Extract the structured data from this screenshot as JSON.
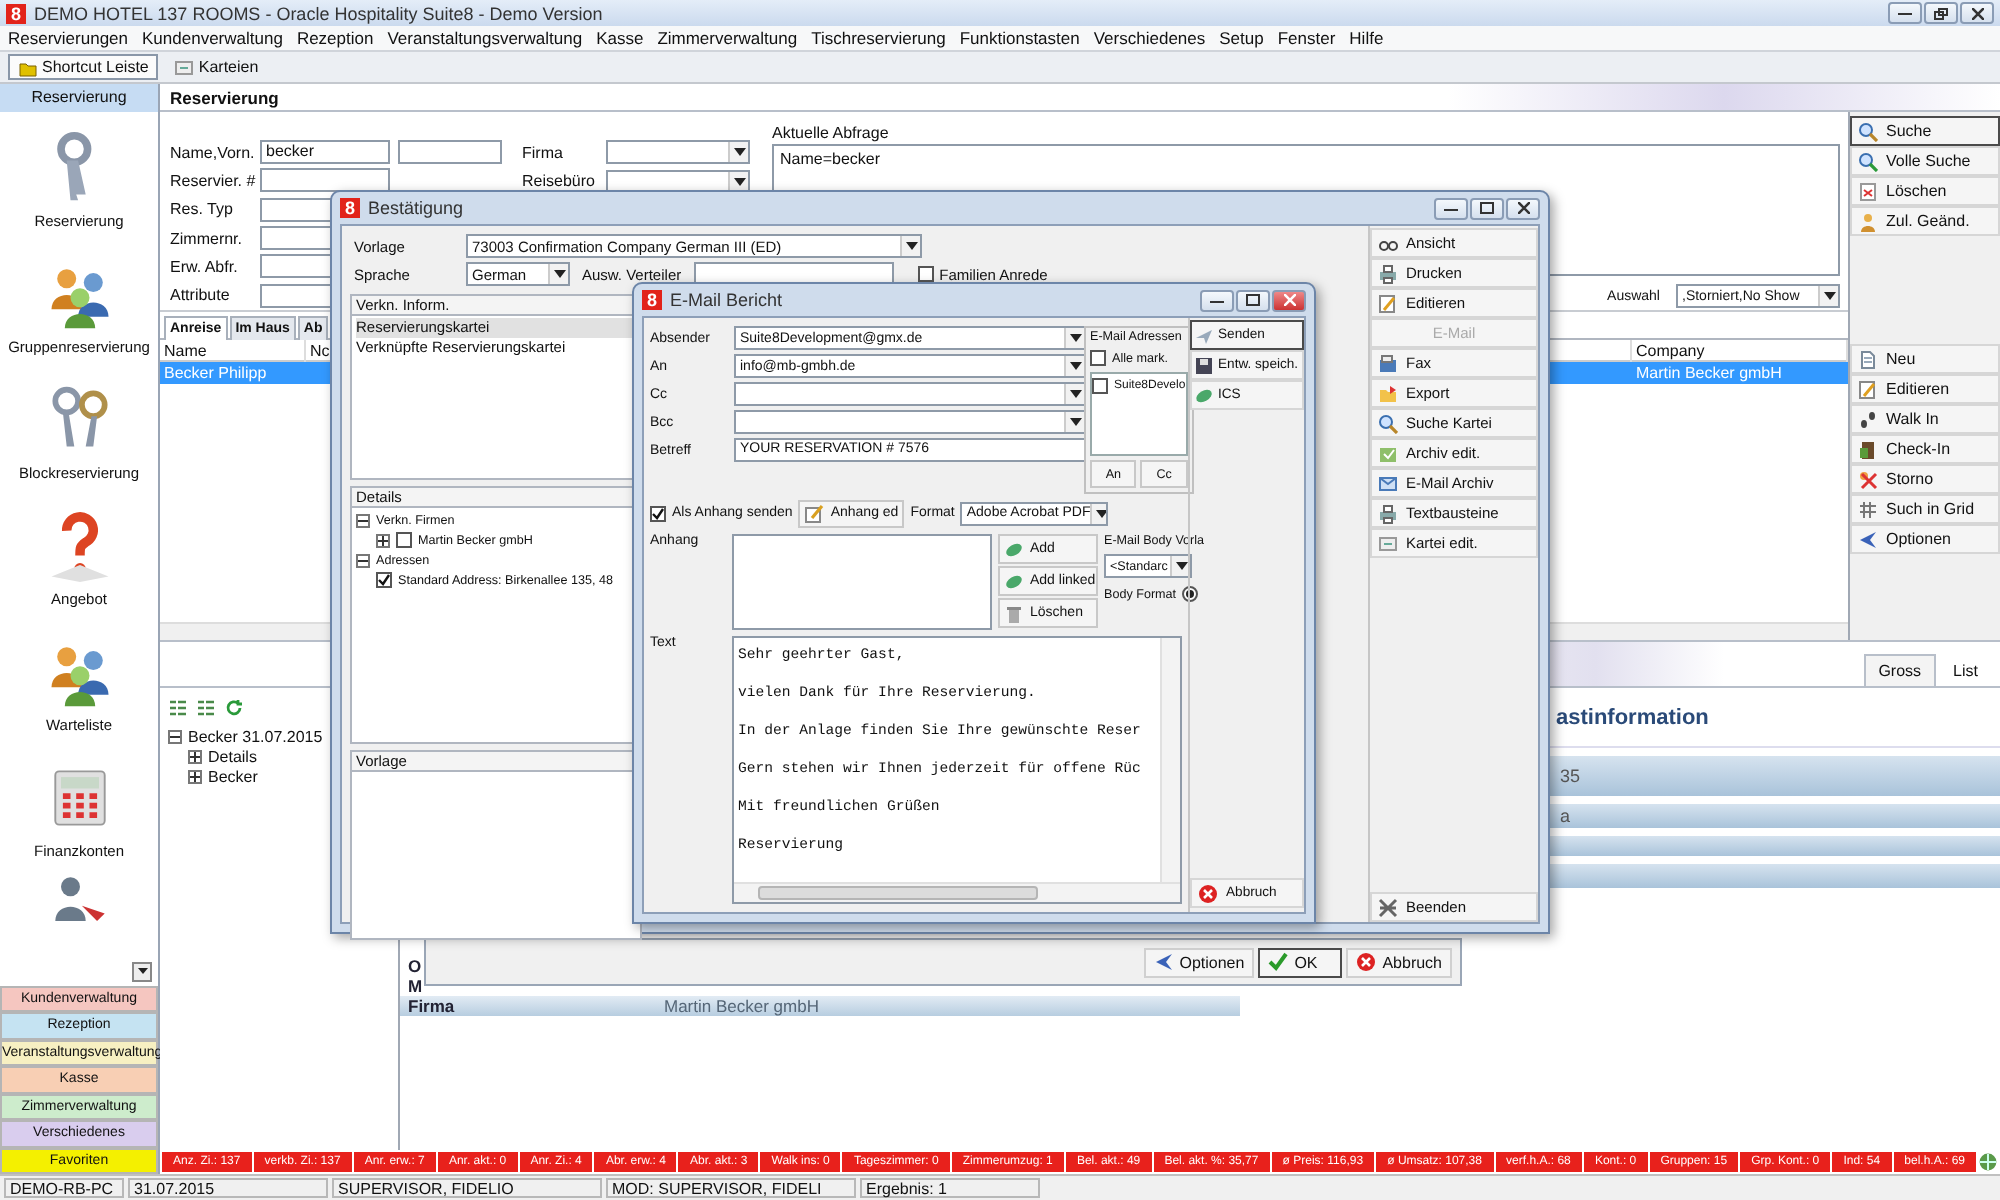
{
  "window": {
    "logo": "8",
    "title": "DEMO HOTEL 137 ROOMS - Oracle Hospitality Suite8 - Demo Version"
  },
  "menu": [
    "Reservierungen",
    "Kundenverwaltung",
    "Rezeption",
    "Veranstaltungsverwaltung",
    "Kasse",
    "Zimmerverwaltung",
    "Tischreservierung",
    "Funktionstasten",
    "Verschiedenes",
    "Setup",
    "Fenster",
    "Hilfe"
  ],
  "toolbar": [
    {
      "label": "Shortcut Leiste",
      "selected": true
    },
    {
      "label": "Karteien",
      "selected": false
    }
  ],
  "sidebar": {
    "header": "Reservierung",
    "items": [
      "Reservierung",
      "Gruppenreservierung",
      "Blockreservierung",
      "Angebot",
      "Warteliste",
      "Finanzkonten"
    ],
    "categories": [
      {
        "label": "Kundenverwaltung",
        "color": "#f5c6c0"
      },
      {
        "label": "Rezeption",
        "color": "#c5e3f2"
      },
      {
        "label": "Veranstaltungsverwaltung",
        "color": "#f7f0c2"
      },
      {
        "label": "Kasse",
        "color": "#f8cfb4"
      },
      {
        "label": "Zimmerverwaltung",
        "color": "#cdeccc"
      },
      {
        "label": "Verschiedenes",
        "color": "#d9cdee"
      },
      {
        "label": "Favoriten",
        "color": "#f4f000"
      }
    ]
  },
  "search": {
    "title": "Reservierung",
    "fields": [
      {
        "label": "Name,Vorn.",
        "value": "becker",
        "kind": "double"
      },
      {
        "label": "Reservier. #",
        "kind": "single"
      },
      {
        "label": "Res. Typ",
        "kind": "single"
      },
      {
        "label": "Zimmernr.",
        "kind": "single"
      },
      {
        "label": "Erw. Abfr.",
        "kind": "single"
      },
      {
        "label": "Attribute",
        "kind": "single"
      }
    ],
    "selects": [
      {
        "label": "Firma"
      },
      {
        "label": "Reisebüro"
      }
    ],
    "query": {
      "label": "Aktuelle Abfrage",
      "value": "Name=becker"
    },
    "auswahl": {
      "label": "Auswahl",
      "value": ",Storniert,No Show"
    }
  },
  "results": {
    "tabs": [
      {
        "label": "Anreise",
        "selected": true
      },
      {
        "label": "Im Haus",
        "selected": false
      },
      {
        "label": "Ab",
        "selected": false
      }
    ],
    "columns": [
      "Name",
      "Nc",
      "Company"
    ],
    "rows": [
      {
        "cells": [
          "Becker Philipp",
          "",
          "Martin Becker gmbH"
        ],
        "selected": true
      }
    ]
  },
  "actions_top": [
    {
      "label": "Suche",
      "default": true
    },
    {
      "label": "Volle Suche",
      "default": false
    },
    {
      "label": "Löschen",
      "default": false
    },
    {
      "label": "Zul. Geänd.",
      "default": false
    }
  ],
  "actions": [
    "Neu",
    "Editieren",
    "Walk In",
    "Check-In",
    "Storno",
    "Such in Grid",
    "Optionen"
  ],
  "lower": {
    "tree": [
      {
        "label": "Becker 31.07.2015",
        "expanded": true,
        "children": [
          {
            "label": "Details",
            "expanded": false
          },
          {
            "label": "Becker",
            "expanded": false
          }
        ]
      }
    ],
    "tabs": [
      {
        "label": "Gross",
        "selected": true
      },
      {
        "label": "List",
        "selected": false
      }
    ],
    "info": {
      "title": "astinformation",
      "lines": [
        "35",
        "a"
      ],
      "rows": [
        {
          "label": "O"
        },
        {
          "label": "M"
        },
        {
          "label": "Firma",
          "value": "Martin Becker gmbH"
        }
      ]
    }
  },
  "stats": [
    "Anz. Zi.: 137",
    "verkb. Zi.: 137",
    "Anr. erw.: 7",
    "Anr. akt.: 0",
    "Anr. Zi.: 4",
    "Abr. erw.: 4",
    "Abr. akt.: 3",
    "Walk ins: 0",
    "Tageszimmer: 0",
    "Zimmerumzug: 1",
    "Bel. akt.: 49",
    "Bel. akt. %: 35,77",
    "ø Preis: 116,93",
    "ø Umsatz: 107,38",
    "verf.h.A.: 68",
    "Kont.: 0",
    "Gruppen: 15",
    "Grp. Kont.: 0",
    "Ind: 54",
    "bel.h.A.: 69"
  ],
  "status": [
    "DEMO-RB-PC",
    "31.07.2015",
    "SUPERVISOR, FIDELIO",
    "MOD: SUPERVISOR, FIDELI",
    "Ergebnis: 1"
  ],
  "confirm": {
    "logo": "8",
    "title": "Bestätigung",
    "vorlage": {
      "label": "Vorlage",
      "value": "73003 Confirmation Company German III (ED)"
    },
    "sprache": {
      "label": "Sprache",
      "value": "German"
    },
    "verteiler": {
      "label": "Ausw. Verteiler"
    },
    "family": {
      "label": "Familien Anrede",
      "checked": false
    },
    "links": {
      "title": "Verkn. Inform.",
      "items": [
        {
          "label": "Reservierungskartei",
          "selected": true
        },
        {
          "label": "Verknüpfte Reservierungskartei",
          "selected": false
        }
      ]
    },
    "details": {
      "title": "Details",
      "tree": [
        {
          "label": "Verkn. Firmen",
          "expanded": true,
          "children": [
            {
              "label": "Martin Becker gmbH",
              "expanded": false,
              "checked": false
            }
          ]
        },
        {
          "label": "Adressen",
          "expanded": true,
          "children": [
            {
              "label": "Standard Address: Birkenallee 135, 48",
              "checked": true
            }
          ]
        }
      ]
    },
    "template_title": "Vorlage",
    "buttons": [
      {
        "label": "Ansicht",
        "disabled": false
      },
      {
        "label": "Drucken",
        "disabled": false
      },
      {
        "label": "Editieren",
        "disabled": false
      },
      {
        "label": "E-Mail",
        "disabled": true
      },
      {
        "label": "Fax",
        "disabled": false
      },
      {
        "label": "Export",
        "disabled": false
      },
      {
        "label": "Suche Kartei",
        "disabled": false
      },
      {
        "label": "Archiv edit.",
        "disabled": false
      },
      {
        "label": "E-Mail Archiv",
        "disabled": false
      },
      {
        "label": "Textbausteine",
        "disabled": false
      },
      {
        "label": "Kartei edit.",
        "disabled": false
      }
    ],
    "exit": "Beenden",
    "footer": [
      {
        "label": "Optionen",
        "default": false
      },
      {
        "label": "OK",
        "default": true
      },
      {
        "label": "Abbruch",
        "default": false
      }
    ]
  },
  "email": {
    "logo": "8",
    "title": "E-Mail Bericht",
    "fields": [
      {
        "label": "Absender",
        "value": "Suite8Development@gmx.de",
        "kind": "dropdown"
      },
      {
        "label": "An",
        "value": "info@mb-gmbh.de",
        "kind": "dropdown"
      },
      {
        "label": "Cc",
        "kind": "dropdown"
      },
      {
        "label": "Bcc",
        "kind": "dropdown"
      },
      {
        "label": "Betreff",
        "value": "YOUR RESERVATION # 7576",
        "kind": "text"
      }
    ],
    "addresses": {
      "title": "E-Mail Adressen",
      "all": {
        "label": "Alle mark.",
        "checked": false
      },
      "items": [
        {
          "label": "Suite8Develo",
          "checked": false
        }
      ],
      "buttons": [
        "An",
        "Cc"
      ]
    },
    "attach_flag": {
      "label": "Als Anhang senden",
      "checked": true
    },
    "attach_edit": "Anhang ed",
    "format": {
      "label": "Format",
      "value": "Adobe Acrobat PDF"
    },
    "attachments": {
      "label": "Anhang",
      "buttons": [
        "Add",
        "Add linked",
        "Löschen"
      ]
    },
    "body": {
      "label": "E-Mail Body Vorla",
      "value": "<Standarc",
      "format_label": "Body Format",
      "selected": true
    },
    "text": {
      "label": "Text",
      "lines": [
        "Sehr geehrter Gast,",
        "vielen Dank für Ihre Reservierung.",
        "In der Anlage finden Sie Ihre gewünschte Reser",
        "Gern stehen wir Ihnen jederzeit für offene Rüc",
        "Mit freundlichen Grüßen",
        "Reservierung"
      ]
    },
    "buttons": [
      {
        "label": "Senden",
        "default": true
      },
      {
        "label": "Entw. speich.",
        "default": false
      },
      {
        "label": "ICS",
        "default": false
      }
    ],
    "cancel": "Abbruch"
  }
}
